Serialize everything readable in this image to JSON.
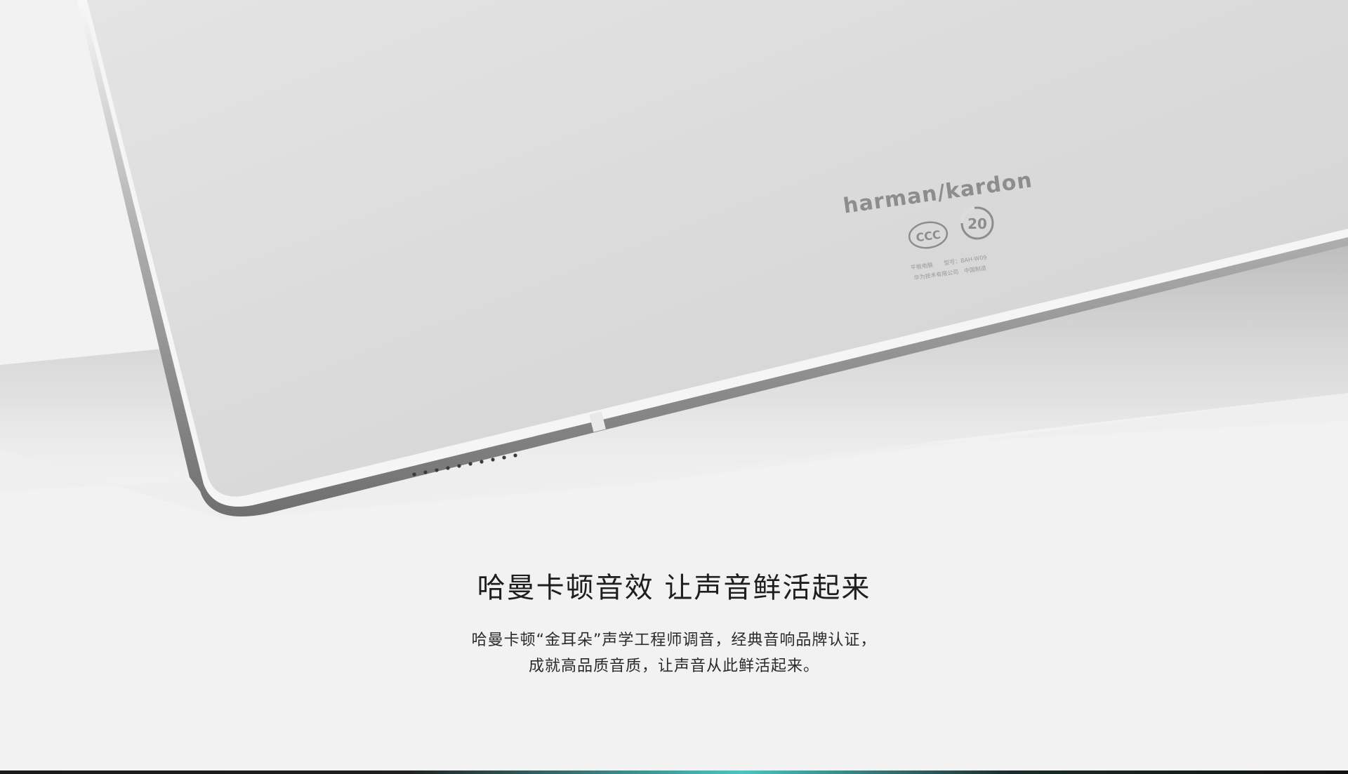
{
  "product": {
    "brand_logo": "harman/kardon",
    "back_label_line1": "平板电脑　　型号：BAH-W09",
    "back_label_line2": "华为技术有限公司　中国制造",
    "cert_badge_text": "CCC",
    "env_badge_text": "20"
  },
  "headline": "哈曼卡顿音效 让声音鲜活起来",
  "description": {
    "line1": "哈曼卡顿“金耳朵”声学工程师调音，经典音响品牌认证，",
    "line2": "成就高品质音质，让声音从此鲜活起来。"
  },
  "colors": {
    "background": "#f2f2f2",
    "tablet_body": "#dcdcdc",
    "accent_bar": "#4fc2c2"
  }
}
